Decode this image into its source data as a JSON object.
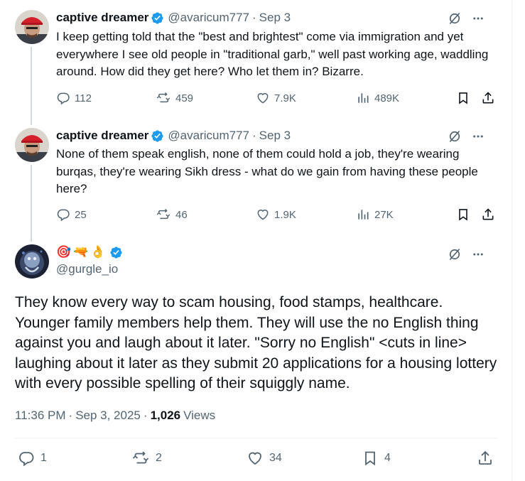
{
  "colors": {
    "verified_blue": "#1d9bf0",
    "secondary_text": "#536471",
    "primary_text": "#0f1419",
    "thread_line": "#cfd9de",
    "divider": "#eff3f4"
  },
  "tweets": [
    {
      "display_name": "captive dreamer",
      "handle": "@avaricum777",
      "separator": "·",
      "date": "Sep 3",
      "text": "I keep getting told that the \"best and brightest\" come via immigration and yet everywhere I see old people in \"traditional garb,\" well past working age, waddling around.  How did they get here?  Who let them in?  Bizarre.",
      "replies": "112",
      "reposts": "459",
      "likes": "7.9K",
      "views": "489K"
    },
    {
      "display_name": "captive dreamer",
      "handle": "@avaricum777",
      "separator": "·",
      "date": "Sep 3",
      "text": "None of them speak english, none of them could hold a job, they're wearing burqas, they're wearing Sikh dress - what do we gain from having these people here?",
      "replies": "25",
      "reposts": "46",
      "likes": "1.9K",
      "views": "27K"
    }
  ],
  "main_tweet": {
    "display_name_emoji": [
      "🎯",
      "🔫",
      "👌"
    ],
    "handle": "@gurgle_io",
    "text": "They know every way to scam housing, food stamps, healthcare. Younger family members help them. They will use the no English thing against you and laugh about it later. \"Sorry no English\" <cuts in line> laughing about it later as they submit 20 applications for a housing lottery with every possible spelling of their squiggly name.",
    "time": "11:36 PM",
    "separator": "·",
    "date": "Sep 3, 2025",
    "views_count": "1,026",
    "views_label": "Views",
    "replies": "1",
    "reposts": "2",
    "likes": "34",
    "bookmarks": "4"
  },
  "icons": {
    "reply": "reply-icon",
    "repost": "repost-icon",
    "like": "heart-icon",
    "views": "analytics-icon",
    "bookmark": "bookmark-icon",
    "share": "share-icon",
    "grok": "grok-icon",
    "more": "more-icon",
    "verified": "verified-badge-icon"
  }
}
